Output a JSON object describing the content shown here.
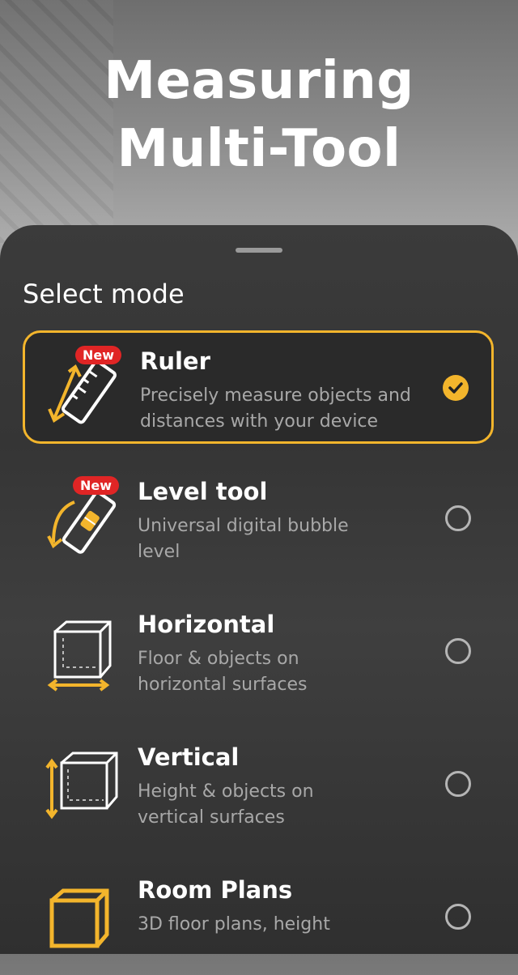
{
  "hero": {
    "line1": "Measuring",
    "line2": "Multi-Tool"
  },
  "sheet": {
    "title": "Select mode"
  },
  "modes": [
    {
      "name": "Ruler",
      "desc": "Precisely measure objects and distances with your device",
      "badge": "New",
      "selected": true
    },
    {
      "name": "Level tool",
      "desc": "Universal digital bubble level",
      "badge": "New",
      "selected": false
    },
    {
      "name": "Horizontal",
      "desc": "Floor & objects on horizontal surfaces",
      "selected": false
    },
    {
      "name": "Vertical",
      "desc": "Height & objects on vertical surfaces",
      "selected": false
    },
    {
      "name": "Room Plans",
      "desc": "3D floor plans, height",
      "selected": false
    }
  ],
  "colors": {
    "accent": "#f3b52c",
    "badge": "#e02525"
  }
}
